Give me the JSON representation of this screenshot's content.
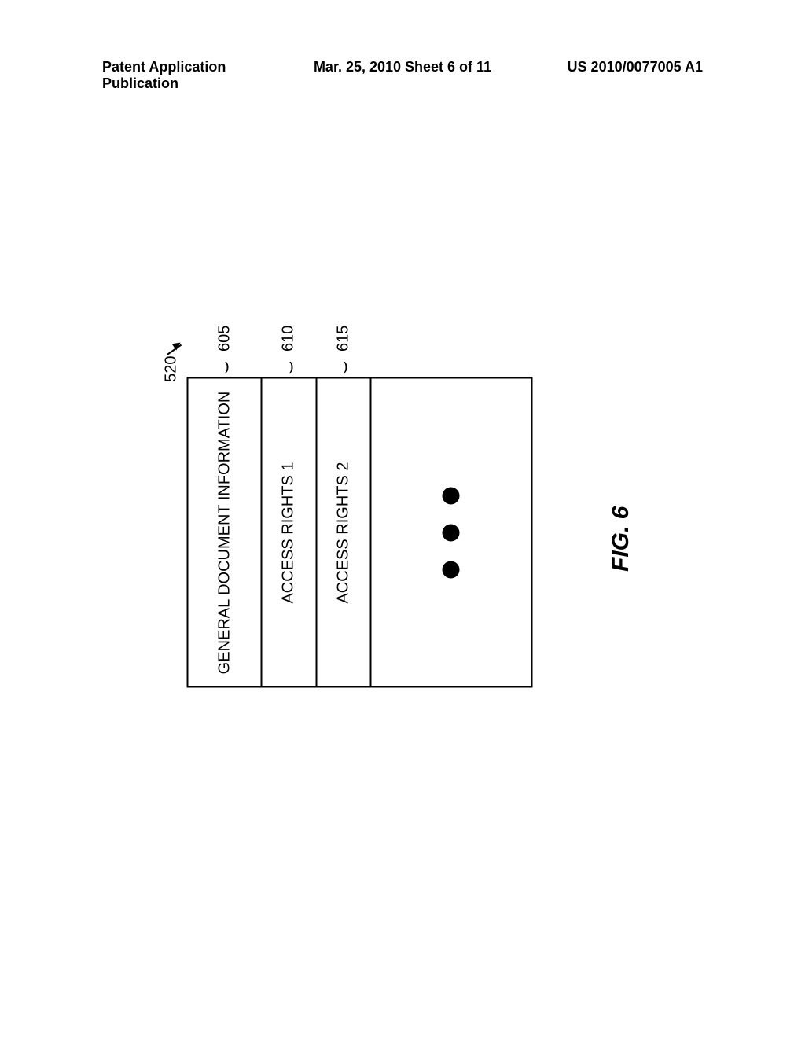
{
  "header": {
    "left": "Patent Application Publication",
    "center": "Mar. 25, 2010  Sheet 6 of 11",
    "right": "US 2010/0077005 A1"
  },
  "diagram": {
    "main_ref": "520",
    "rows": [
      {
        "label": "GENERAL DOCUMENT INFORMATION",
        "ref": "605"
      },
      {
        "label": "ACCESS RIGHTS 1",
        "ref": "610"
      },
      {
        "label": "ACCESS RIGHTS 2",
        "ref": "615"
      }
    ]
  },
  "figure_label": "FIG. 6"
}
